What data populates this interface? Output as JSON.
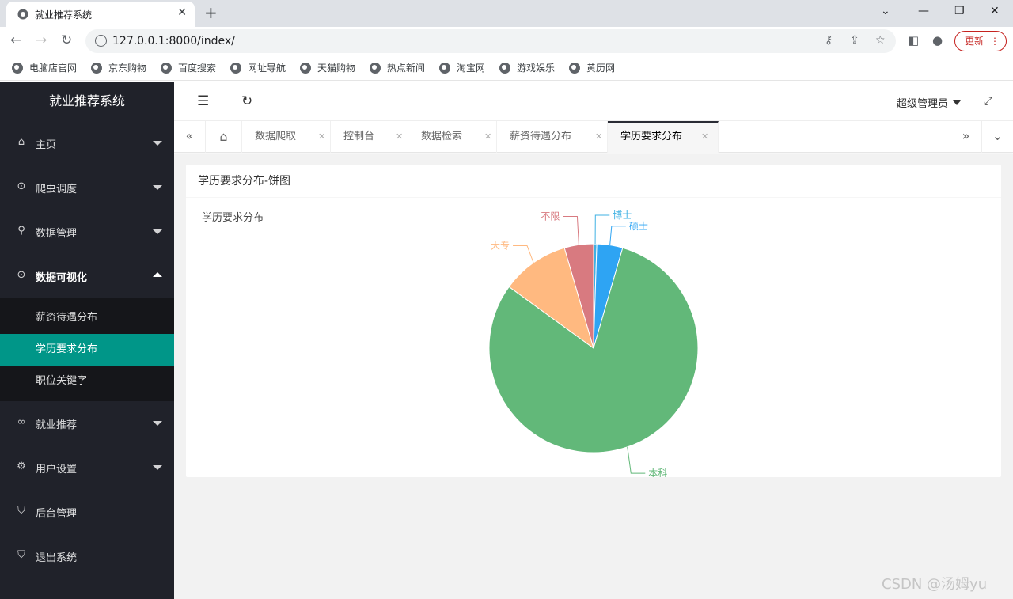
{
  "browser": {
    "tab_title": "就业推荐系统",
    "tab_close": "✕",
    "new_tab": "+",
    "url": "127.0.0.1:8000/index/",
    "update_label": "更新",
    "bookmarks": [
      "电脑店官网",
      "京东购物",
      "百度搜索",
      "网址导航",
      "天猫购物",
      "热点新闻",
      "淘宝网",
      "游戏娱乐",
      "黄历网"
    ]
  },
  "sidebar": {
    "logo": "就业推荐系统",
    "menu": [
      {
        "label": "主页",
        "icon": "home-icon"
      },
      {
        "label": "爬虫调度",
        "icon": "download-circle-icon"
      },
      {
        "label": "数据管理",
        "icon": "search-icon"
      },
      {
        "label": "数据可视化",
        "icon": "download-circle-icon"
      },
      {
        "label": "就业推荐",
        "icon": "link-icon"
      },
      {
        "label": "用户设置",
        "icon": "gear-icon"
      },
      {
        "label": "后台管理",
        "icon": "shield-icon"
      },
      {
        "label": "退出系统",
        "icon": "shield-icon"
      }
    ],
    "submenu": [
      "薪资待遇分布",
      "学历要求分布",
      "职位关键字"
    ],
    "selected_submenu": "学历要求分布"
  },
  "header": {
    "admin": "超级管理员"
  },
  "page_tabs": [
    "数据爬取",
    "控制台",
    "数据检索",
    "薪资待遇分布",
    "学历要求分布"
  ],
  "card": {
    "title": "学历要求分布-饼图"
  },
  "chart_data": {
    "type": "pie",
    "title": "学历要求分布",
    "categories": [
      "博士",
      "硕士",
      "本科",
      "大专",
      "不限"
    ],
    "values": [
      0.5,
      4.0,
      80.5,
      10.5,
      4.5
    ],
    "colors": [
      "#3fb1e3",
      "#2ea4f3",
      "#62b879",
      "#ffb980",
      "#d87a80"
    ]
  },
  "watermark": "CSDN @汤姆yu"
}
